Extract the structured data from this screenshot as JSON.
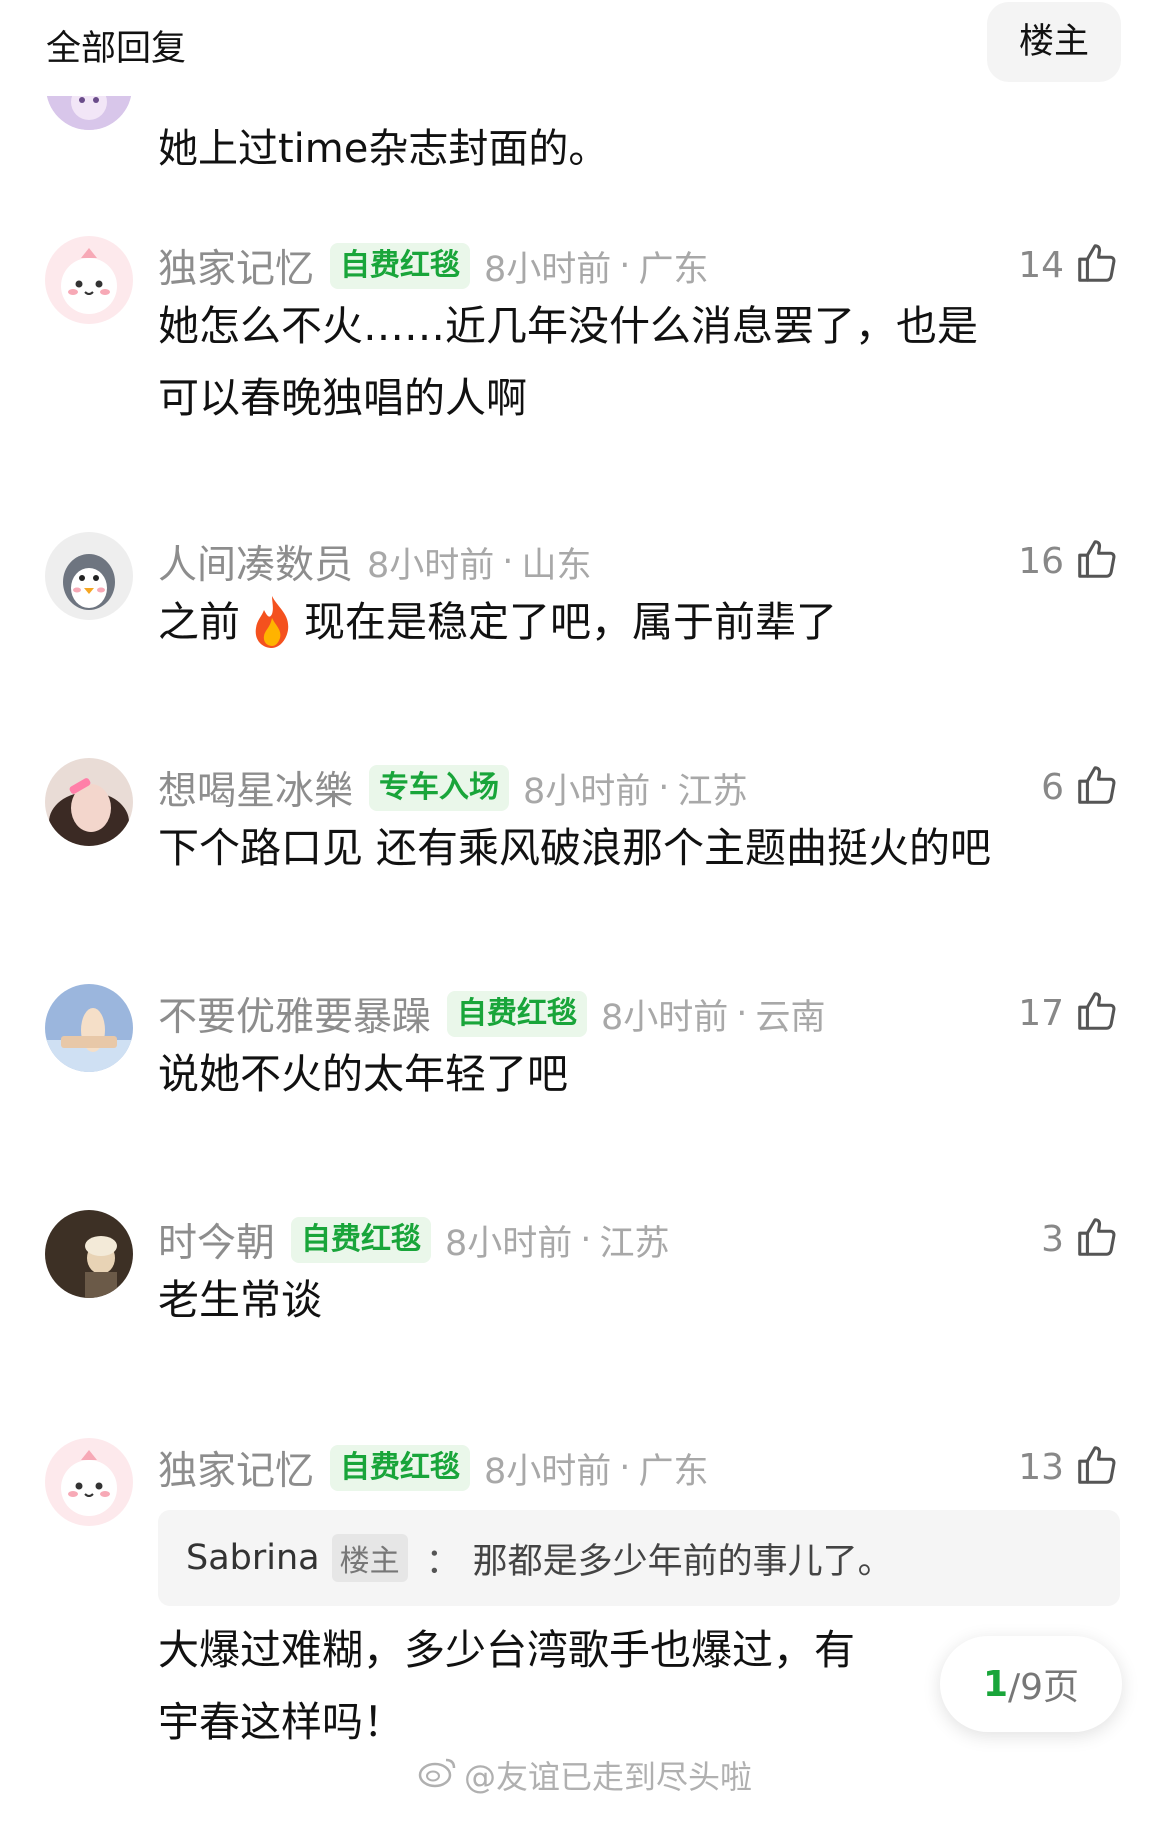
{
  "header": {
    "title": "全部回复",
    "op_button": "楼主"
  },
  "top_fragment": {
    "text": "她上过time杂志封面的。"
  },
  "comments": [
    {
      "username": "独家记忆",
      "badge": "自费红毯",
      "time": "8小时前",
      "location": "广东",
      "likes": "14",
      "lines": [
        "她怎么不火……近几年没什么消息罢了，也是",
        "可以春晚独唱的人啊"
      ]
    },
    {
      "username": "人间凑数员",
      "badge": "",
      "time": "8小时前",
      "location": "山东",
      "likes": "16",
      "parts": [
        "之前",
        "现在是稳定了吧，属于前辈了"
      ]
    },
    {
      "username": "想喝星冰樂",
      "badge": "专车入场",
      "time": "8小时前",
      "location": "江苏",
      "likes": "6",
      "lines": [
        "下个路口见 还有乘风破浪那个主题曲挺火的吧"
      ]
    },
    {
      "username": "不要优雅要暴躁",
      "badge": "自费红毯",
      "time": "8小时前",
      "location": "云南",
      "likes": "17",
      "lines": [
        "说她不火的太年轻了吧"
      ]
    },
    {
      "username": "时今朝",
      "badge": "自费红毯",
      "time": "8小时前",
      "location": "江苏",
      "likes": "3",
      "lines": [
        "老生常谈"
      ]
    },
    {
      "username": "独家记忆",
      "badge": "自费红毯",
      "time": "8小时前",
      "location": "广东",
      "likes": "13",
      "quote": {
        "name": "Sabrina",
        "badge": "楼主",
        "separator": "：",
        "text": "那都是多少年前的事儿了。"
      },
      "lines": [
        "大爆过难糊，多少台湾歌手也爆过，有",
        "宇春这样吗！"
      ]
    }
  ],
  "pager": {
    "current": "1",
    "total": "/9页"
  },
  "watermark": {
    "text": "@友谊已走到尽头啦"
  },
  "colors": {
    "badge_green": "#19a53a",
    "badge_bg": "#eaf7ea",
    "meta_gray": "#a8a8a8"
  },
  "icons": {
    "like": "thumbs-up-icon",
    "fire": "fire-emoji-icon",
    "weibo": "weibo-logo-icon"
  }
}
